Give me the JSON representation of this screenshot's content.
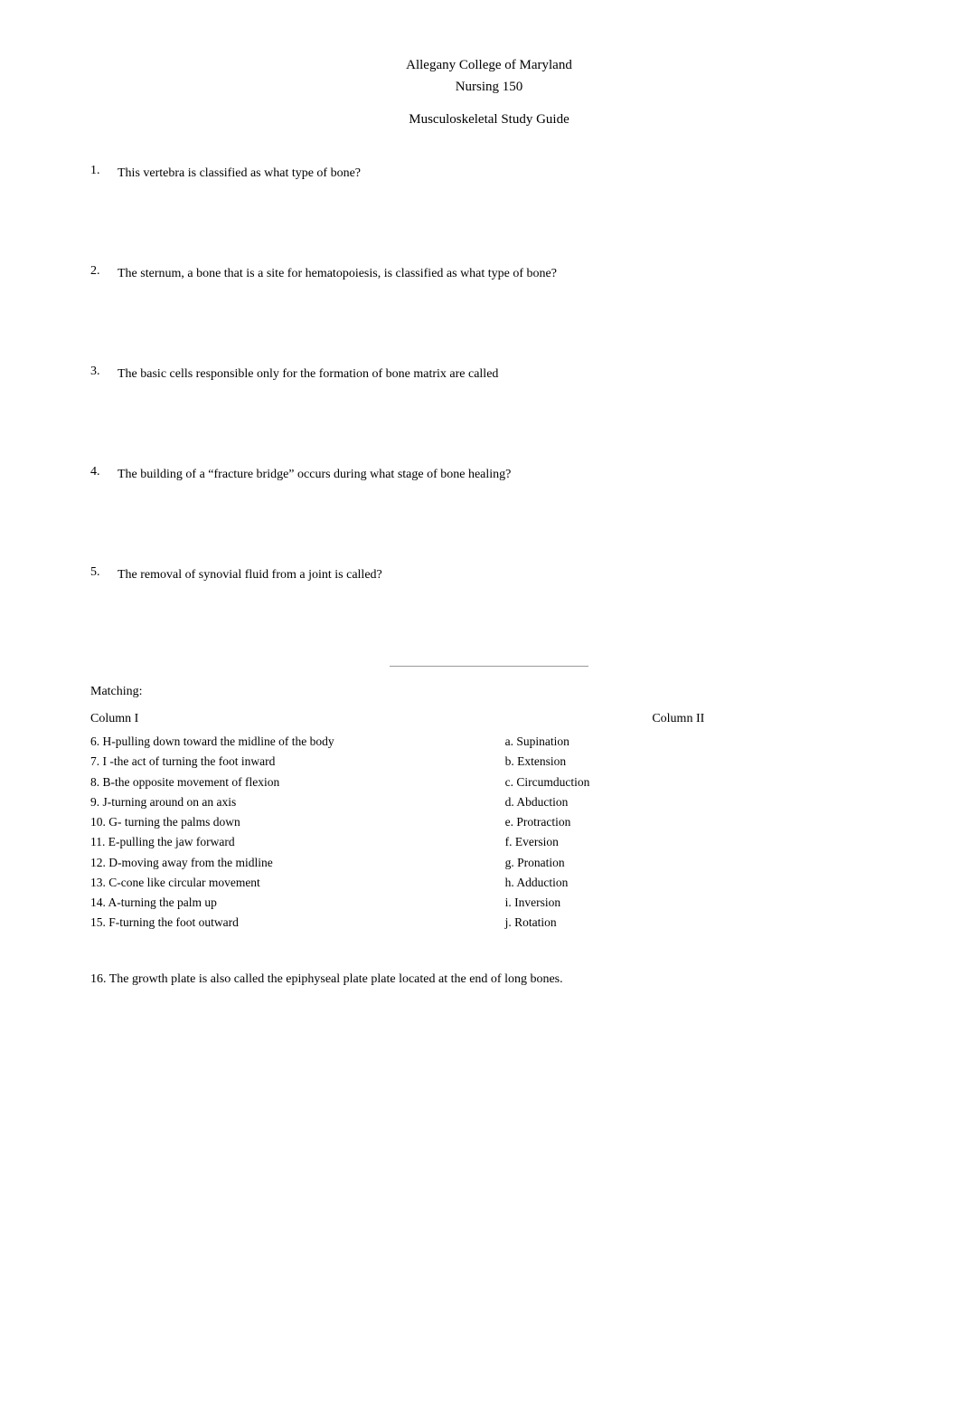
{
  "header": {
    "line1": "Allegany College of Maryland",
    "line2": "Nursing 150",
    "line3": "Musculoskeletal Study Guide"
  },
  "questions": [
    {
      "number": "1.",
      "text": "This vertebra is classified as what type of bone?"
    },
    {
      "number": "2.",
      "text": "The sternum, a bone that is a site for hematopoiesis, is classified as what type of bone?"
    },
    {
      "number": "3.",
      "text": "The basic cells responsible only for the formation of bone matrix are called"
    },
    {
      "number": "4.",
      "text": "The building of a “fracture bridge” occurs during what stage of bone healing?"
    },
    {
      "number": "5.",
      "text": "The removal of synovial fluid from a joint is called?"
    }
  ],
  "matching": {
    "label": "Matching:",
    "column_left_header": "Column I",
    "column_right_header": "Column II",
    "left_items": [
      "6.   H-pulling down toward the midline of the body",
      "7.   I -the act of turning the foot inward",
      "8.   B-the opposite movement of flexion",
      "9.   J-turning around on an axis",
      "10. G- turning the palms down",
      "11. E-pulling the jaw forward",
      "12. D-moving away from the midline",
      "13. C-cone like circular movement",
      "14. A-turning the palm up",
      "15. F-turning the foot outward"
    ],
    "right_items": [
      "a. Supination",
      "b. Extension",
      "c. Circumduction",
      "d. Abduction",
      "e. Protraction",
      "f. Eversion",
      "g. Pronation",
      "h. Adduction",
      "i. Inversion",
      "j. Rotation"
    ]
  },
  "question16": {
    "text": "16. The growth plate is also called the epiphyseal plate  plate located at the end of long bones."
  }
}
